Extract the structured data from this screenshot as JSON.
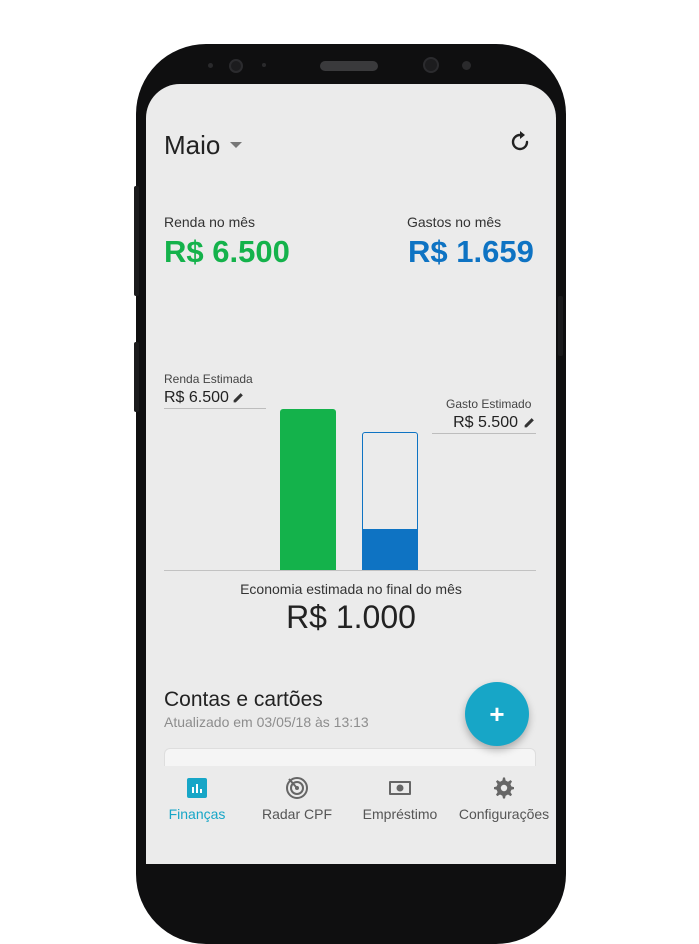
{
  "header": {
    "month": "Maio",
    "refresh_icon": "refresh-icon",
    "dropdown_icon": "chevron-down-icon"
  },
  "summary": {
    "income_label": "Renda no mês",
    "income_value": "R$ 6.500",
    "expense_label": "Gastos no mês",
    "expense_value": "R$ 1.659"
  },
  "estimates": {
    "income_label": "Renda Estimada",
    "income_value": "R$ 6.500",
    "expense_label": "Gasto Estimado",
    "expense_value": "R$ 5.500",
    "expense_spent_fraction": 0.3
  },
  "savings": {
    "label": "Economia estimada no final do mês",
    "value": "R$ 1.000"
  },
  "accounts": {
    "title": "Contas e cartões",
    "updated": "Atualizado em 03/05/18 às 13:13"
  },
  "fab": {
    "label": "+"
  },
  "nav": [
    {
      "label": "Finanças",
      "icon": "bar-chart-icon",
      "active": true
    },
    {
      "label": "Radar CPF",
      "icon": "radar-icon",
      "active": false
    },
    {
      "label": "Empréstimo",
      "icon": "money-icon",
      "active": false
    },
    {
      "label": "Configurações",
      "icon": "gear-icon",
      "active": false
    }
  ],
  "colors": {
    "income": "#14b24b",
    "expense": "#0e73c3",
    "accent": "#17a6c7"
  }
}
